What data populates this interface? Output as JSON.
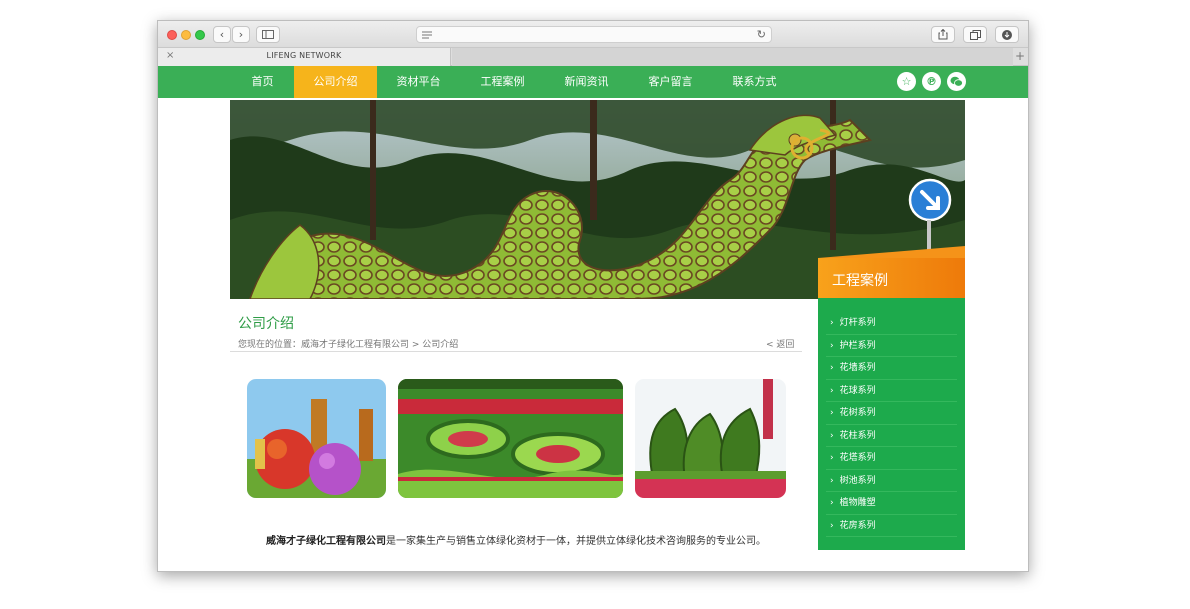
{
  "browser": {
    "tab_title": "LIFENG NETWORK",
    "tab_close": "×",
    "new_tab": "+",
    "back": "‹",
    "forward": "›"
  },
  "nav": {
    "items": [
      "首页",
      "公司介绍",
      "资材平台",
      "工程案例",
      "新闻资讯",
      "客户留言",
      "联系方式"
    ],
    "active_index": 1
  },
  "page": {
    "section_title": "公司介绍",
    "breadcrumb": "您现在的位置：威海才子绿化工程有限公司 > 公司介绍",
    "back_link": "< 返回",
    "intro_company": "威海才子绿化工程有限公司",
    "intro_text": "是一家集生产与销售立体绿化资材于一体，并提供立体绿化技术咨询服务的专业公司。"
  },
  "sidebar": {
    "title": "工程案例",
    "items": [
      "灯杆系列",
      "护栏系列",
      "花墙系列",
      "花球系列",
      "花树系列",
      "花柱系列",
      "花塔系列",
      "树池系列",
      "植物雕塑",
      "花房系列"
    ]
  },
  "colors": {
    "nav_green": "#3aaf56",
    "active_orange": "#f6b41b",
    "sidebar_green": "#1daa4c",
    "sidebar_head_orange": "#f08a12",
    "title_green": "#2e9c46"
  }
}
